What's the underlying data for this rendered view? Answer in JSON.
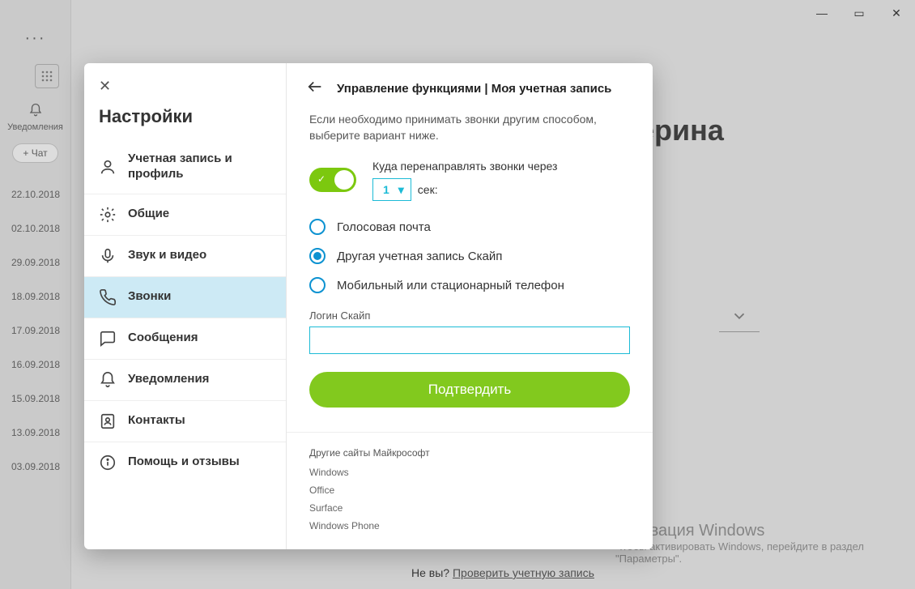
{
  "window": {
    "minimize_glyph": "―",
    "maximize_glyph": "▭",
    "close_glyph": "✕"
  },
  "background": {
    "more_glyph": "···",
    "bell_label": "Уведомления",
    "chat_button": "+ Чат",
    "dates": [
      "22.10.2018",
      "02.10.2018",
      "29.09.2018",
      "18.09.2018",
      "17.09.2018",
      "16.09.2018",
      "15.09.2018",
      "13.09.2018",
      "03.09.2018"
    ],
    "contact_name_partial": "ерина",
    "not_you_prefix": "Не вы? ",
    "not_you_link": "Проверить учетную запись"
  },
  "watermark": {
    "line1": "Активация Windows",
    "line2": "Чтобы активировать Windows, перейдите в раздел \"Параметры\"."
  },
  "modal": {
    "heading": "Настройки",
    "nav": [
      {
        "label": "Учетная запись и профиль"
      },
      {
        "label": "Общие"
      },
      {
        "label": "Звук и видео"
      },
      {
        "label": "Звонки"
      },
      {
        "label": "Сообщения"
      },
      {
        "label": "Уведомления"
      },
      {
        "label": "Контакты"
      },
      {
        "label": "Помощь и отзывы"
      }
    ],
    "content": {
      "title": "Управление функциями | Моя учетная запись",
      "instruction": "Если необходимо принимать звонки другим способом, выберите вариант ниже.",
      "forward_label": "Куда перенаправлять звонки через",
      "forward_seconds_value": "1",
      "seconds_suffix": "сек:",
      "radios": {
        "voicemail": "Голосовая почта",
        "other_skype": "Другая учетная запись Скайп",
        "phone": "Мобильный или стационарный телефон"
      },
      "login_label": "Логин Скайп",
      "login_value": "",
      "confirm": "Подтвердить",
      "ms_heading": "Другие сайты Майкрософт",
      "ms_links": [
        "Windows",
        "Office",
        "Surface",
        "Windows Phone"
      ]
    }
  }
}
